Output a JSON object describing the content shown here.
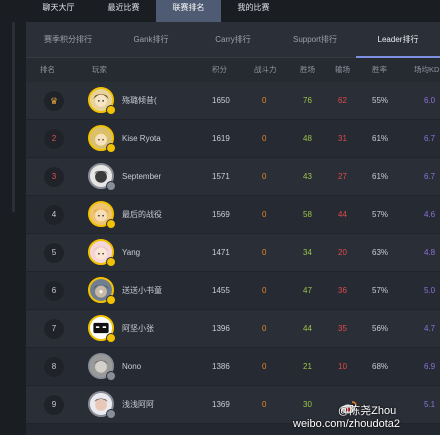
{
  "nav": {
    "tabs": [
      {
        "label": "聊天大厅",
        "active": false
      },
      {
        "label": "最近比赛",
        "active": false
      },
      {
        "label": "联赛排名",
        "active": true
      },
      {
        "label": "我的比赛",
        "active": false
      }
    ]
  },
  "subtabs": [
    {
      "label": "赛季积分排行",
      "active": false
    },
    {
      "label": "Gank排行",
      "active": false
    },
    {
      "label": "Carry排行",
      "active": false
    },
    {
      "label": "Support排行",
      "active": false
    },
    {
      "label": "Leader排行",
      "active": true
    }
  ],
  "table": {
    "headers": {
      "rank": "排名",
      "player": "玩家",
      "score": "积分",
      "power": "战斗力",
      "wins": "胜场",
      "losses": "输场",
      "winrate": "胜率",
      "kda": "场均KD"
    },
    "rows": [
      {
        "rank": "♛",
        "name": "殇璐倾昔(",
        "score": "1650",
        "power": "0",
        "wins": "76",
        "losses": "62",
        "winrate": "55%",
        "kda": "6.0",
        "avatar": "anime-yellow"
      },
      {
        "rank": "2",
        "name": "Kise Ryota",
        "score": "1619",
        "power": "0",
        "wins": "48",
        "losses": "31",
        "winrate": "61%",
        "kda": "6.7",
        "avatar": "anime-blond"
      },
      {
        "rank": "3",
        "name": "September",
        "score": "1571",
        "power": "0",
        "wins": "43",
        "losses": "27",
        "winrate": "61%",
        "kda": "6.7",
        "avatar": "dark-face"
      },
      {
        "rank": "4",
        "name": "最后的战役",
        "score": "1569",
        "power": "0",
        "wins": "58",
        "losses": "44",
        "winrate": "57%",
        "kda": "4.6",
        "avatar": "anime-orange"
      },
      {
        "rank": "5",
        "name": "Yang",
        "score": "1471",
        "power": "0",
        "wins": "34",
        "losses": "20",
        "winrate": "63%",
        "kda": "4.8",
        "avatar": "anime-pink"
      },
      {
        "rank": "6",
        "name": "送送小书童",
        "score": "1455",
        "power": "0",
        "wins": "47",
        "losses": "36",
        "winrate": "57%",
        "kda": "5.0",
        "avatar": "dark-char"
      },
      {
        "rank": "7",
        "name": "阿坚小张",
        "score": "1396",
        "power": "0",
        "wins": "44",
        "losses": "35",
        "winrate": "56%",
        "kda": "4.7",
        "avatar": "cartoon-bw"
      },
      {
        "rank": "8",
        "name": "Nono",
        "score": "1386",
        "power": "0",
        "wins": "21",
        "losses": "10",
        "winrate": "68%",
        "kda": "6.9",
        "avatar": "photo-gray"
      },
      {
        "rank": "9",
        "name": "浅浅阿阿",
        "score": "1369",
        "power": "0",
        "wins": "30",
        "losses": "",
        "winrate": "",
        "kda": "5.1",
        "avatar": "photo-light"
      }
    ]
  },
  "watermark": {
    "line1": "@陈尧Zhou",
    "line2": "weibo.com/zhoudota2"
  },
  "colors": {
    "power": "#e8852f",
    "wins": "#9bc44a",
    "losses": "#e04a4a",
    "kda": "#8c72d8",
    "active_tab": "#4f5a73"
  }
}
